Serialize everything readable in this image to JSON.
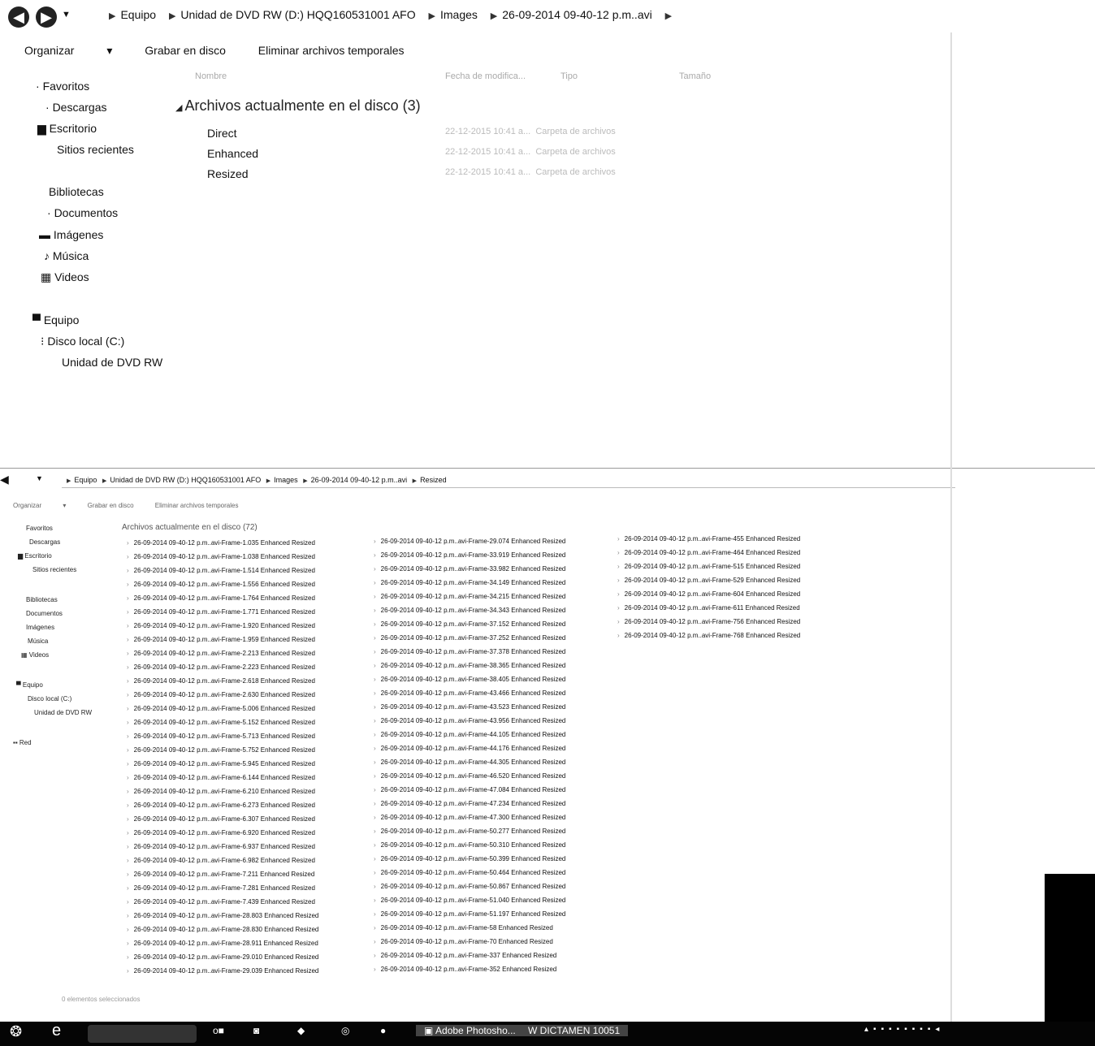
{
  "window1": {
    "breadcrumb": [
      "Equipo",
      "Unidad de DVD RW (D:) HQQ160531001 AFO",
      "Images",
      "26-09-2014 09-40-12 p.m..avi"
    ],
    "toolbar": {
      "organize": "Organizar",
      "burn": "Grabar en disco",
      "delete_temp": "Eliminar archivos temporales"
    },
    "columns": {
      "name": "Nombre",
      "date": "Fecha de modifica...",
      "type": "Tipo",
      "size": "Tamaño"
    },
    "sidebar": {
      "favorites": "Favoritos",
      "downloads": "Descargas",
      "desktop": "Escritorio",
      "recent": "Sitios recientes",
      "libraries": "Bibliotecas",
      "documents": "Documentos",
      "images": "Imágenes",
      "music": "Música",
      "videos": "Videos",
      "computer": "Equipo",
      "local_disk": "Disco local (C:)",
      "dvd": "Unidad de DVD RW"
    },
    "group_header": "Archivos actualmente en el disco (3)",
    "items": [
      {
        "name": "Direct",
        "date": "22-12-2015 10:41 a...",
        "type": "Carpeta de archivos"
      },
      {
        "name": "Enhanced",
        "date": "22-12-2015 10:41 a...",
        "type": "Carpeta de archivos"
      },
      {
        "name": "Resized",
        "date": "22-12-2015 10:41 a...",
        "type": "Carpeta de archivos"
      }
    ]
  },
  "window2": {
    "breadcrumb": [
      "Equipo",
      "Unidad de DVD RW (D:) HQQ160531001 AFO",
      "Images",
      "26-09-2014 09-40-12 p.m..avi",
      "Resized"
    ],
    "toolbar": {
      "organize": "Organizar",
      "burn": "Grabar en disco",
      "delete_temp": "Eliminar archivos temporales"
    },
    "sidebar": {
      "favorites": "Favoritos",
      "downloads": "Descargas",
      "desktop": "Escritorio",
      "recent": "Sitios recientes",
      "libraries": "Bibliotecas",
      "documents": "Documentos",
      "images": "Imágenes",
      "music": "Música",
      "videos": "Videos",
      "computer": "Equipo",
      "local_disk": "Disco local (C:)",
      "dvd": "Unidad de DVD RW",
      "network": "Red"
    },
    "group_header": "Archivos actualmente en el disco (72)",
    "status": "0 elementos seleccionados",
    "files_col1": [
      "26-09-2014 09-40-12 p.m..avi-Frame-1.035 Enhanced Resized",
      "26-09-2014 09-40-12 p.m..avi-Frame-1.038 Enhanced Resized",
      "26-09-2014 09-40-12 p.m..avi-Frame-1.514 Enhanced Resized",
      "26-09-2014 09-40-12 p.m..avi-Frame-1.556 Enhanced Resized",
      "26-09-2014 09-40-12 p.m..avi-Frame-1.764 Enhanced Resized",
      "26-09-2014 09-40-12 p.m..avi-Frame-1.771 Enhanced Resized",
      "26-09-2014 09-40-12 p.m..avi-Frame-1.920 Enhanced Resized",
      "26-09-2014 09-40-12 p.m..avi-Frame-1.959 Enhanced Resized",
      "26-09-2014 09-40-12 p.m..avi-Frame-2.213 Enhanced Resized",
      "26-09-2014 09-40-12 p.m..avi-Frame-2.223 Enhanced Resized",
      "26-09-2014 09-40-12 p.m..avi-Frame-2.618 Enhanced Resized",
      "26-09-2014 09-40-12 p.m..avi-Frame-2.630 Enhanced Resized",
      "26-09-2014 09-40-12 p.m..avi-Frame-5.006 Enhanced Resized",
      "26-09-2014 09-40-12 p.m..avi-Frame-5.152 Enhanced Resized",
      "26-09-2014 09-40-12 p.m..avi-Frame-5.713 Enhanced Resized",
      "26-09-2014 09-40-12 p.m..avi-Frame-5.752 Enhanced Resized",
      "26-09-2014 09-40-12 p.m..avi-Frame-5.945 Enhanced Resized",
      "26-09-2014 09-40-12 p.m..avi-Frame-6.144 Enhanced Resized",
      "26-09-2014 09-40-12 p.m..avi-Frame-6.210 Enhanced Resized",
      "26-09-2014 09-40-12 p.m..avi-Frame-6.273 Enhanced Resized",
      "26-09-2014 09-40-12 p.m..avi-Frame-6.307 Enhanced Resized",
      "26-09-2014 09-40-12 p.m..avi-Frame-6.920 Enhanced Resized",
      "26-09-2014 09-40-12 p.m..avi-Frame-6.937 Enhanced Resized",
      "26-09-2014 09-40-12 p.m..avi-Frame-6.982 Enhanced Resized",
      "26-09-2014 09-40-12 p.m..avi-Frame-7.211 Enhanced Resized",
      "26-09-2014 09-40-12 p.m..avi-Frame-7.281 Enhanced Resized",
      "26-09-2014 09-40-12 p.m..avi-Frame-7.439 Enhanced Resized",
      "26-09-2014 09-40-12 p.m..avi-Frame-28.803 Enhanced Resized",
      "26-09-2014 09-40-12 p.m..avi-Frame-28.830 Enhanced Resized",
      "26-09-2014 09-40-12 p.m..avi-Frame-28.911 Enhanced Resized",
      "26-09-2014 09-40-12 p.m..avi-Frame-29.010 Enhanced Resized",
      "26-09-2014 09-40-12 p.m..avi-Frame-29.039 Enhanced Resized"
    ],
    "files_col2": [
      "26-09-2014 09-40-12 p.m..avi-Frame-29.074 Enhanced Resized",
      "26-09-2014 09-40-12 p.m..avi-Frame-33.919 Enhanced Resized",
      "26-09-2014 09-40-12 p.m..avi-Frame-33.982 Enhanced Resized",
      "26-09-2014 09-40-12 p.m..avi-Frame-34.149 Enhanced Resized",
      "26-09-2014 09-40-12 p.m..avi-Frame-34.215 Enhanced Resized",
      "26-09-2014 09-40-12 p.m..avi-Frame-34.343 Enhanced Resized",
      "26-09-2014 09-40-12 p.m..avi-Frame-37.152 Enhanced Resized",
      "26-09-2014 09-40-12 p.m..avi-Frame-37.252 Enhanced Resized",
      "26-09-2014 09-40-12 p.m..avi-Frame-37.378 Enhanced Resized",
      "26-09-2014 09-40-12 p.m..avi-Frame-38.365 Enhanced Resized",
      "26-09-2014 09-40-12 p.m..avi-Frame-38.405 Enhanced Resized",
      "26-09-2014 09-40-12 p.m..avi-Frame-43.466 Enhanced Resized",
      "26-09-2014 09-40-12 p.m..avi-Frame-43.523 Enhanced Resized",
      "26-09-2014 09-40-12 p.m..avi-Frame-43.956 Enhanced Resized",
      "26-09-2014 09-40-12 p.m..avi-Frame-44.105 Enhanced Resized",
      "26-09-2014 09-40-12 p.m..avi-Frame-44.176 Enhanced Resized",
      "26-09-2014 09-40-12 p.m..avi-Frame-44.305 Enhanced Resized",
      "26-09-2014 09-40-12 p.m..avi-Frame-46.520 Enhanced Resized",
      "26-09-2014 09-40-12 p.m..avi-Frame-47.084 Enhanced Resized",
      "26-09-2014 09-40-12 p.m..avi-Frame-47.234 Enhanced Resized",
      "26-09-2014 09-40-12 p.m..avi-Frame-47.300 Enhanced Resized",
      "26-09-2014 09-40-12 p.m..avi-Frame-50.277 Enhanced Resized",
      "26-09-2014 09-40-12 p.m..avi-Frame-50.310 Enhanced Resized",
      "26-09-2014 09-40-12 p.m..avi-Frame-50.399 Enhanced Resized",
      "26-09-2014 09-40-12 p.m..avi-Frame-50.464 Enhanced Resized",
      "26-09-2014 09-40-12 p.m..avi-Frame-50.867 Enhanced Resized",
      "26-09-2014 09-40-12 p.m..avi-Frame-51.040 Enhanced Resized",
      "26-09-2014 09-40-12 p.m..avi-Frame-51.197 Enhanced Resized",
      "26-09-2014 09-40-12 p.m..avi-Frame-58 Enhanced Resized",
      "26-09-2014 09-40-12 p.m..avi-Frame-70 Enhanced Resized",
      "26-09-2014 09-40-12 p.m..avi-Frame-337 Enhanced Resized",
      "26-09-2014 09-40-12 p.m..avi-Frame-352 Enhanced Resized"
    ],
    "files_col3": [
      "26-09-2014 09-40-12 p.m..avi-Frame-455 Enhanced Resized",
      "26-09-2014 09-40-12 p.m..avi-Frame-464 Enhanced Resized",
      "26-09-2014 09-40-12 p.m..avi-Frame-515 Enhanced Resized",
      "26-09-2014 09-40-12 p.m..avi-Frame-529 Enhanced Resized",
      "26-09-2014 09-40-12 p.m..avi-Frame-604 Enhanced Resized",
      "26-09-2014 09-40-12 p.m..avi-Frame-611 Enhanced Resized",
      "26-09-2014 09-40-12 p.m..avi-Frame-756 Enhanced Resized",
      "26-09-2014 09-40-12 p.m..avi-Frame-768 Enhanced Resized"
    ]
  },
  "taskbar": {
    "item1": "Adobe Photosho...",
    "item2": "DICTAMEN 10051"
  }
}
